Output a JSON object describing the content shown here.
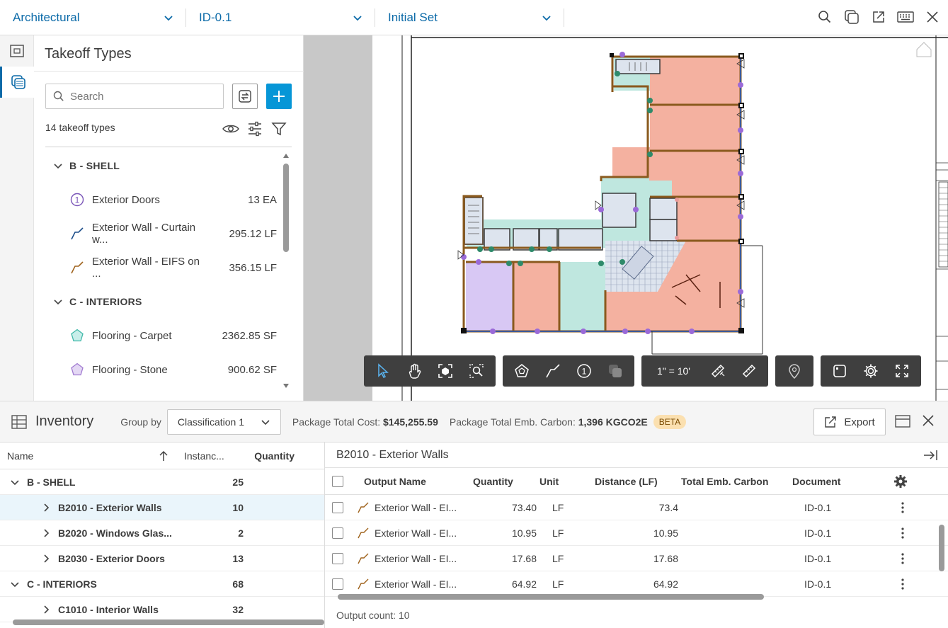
{
  "topbar": {
    "discipline": "Architectural",
    "sheet": "ID-0.1",
    "version_set": "Initial Set",
    "icons": [
      "search-icon",
      "compare-icon",
      "share-icon",
      "keyboard-icon",
      "close-icon"
    ]
  },
  "rail": {
    "icons": [
      "sheets-icon",
      "takeoff-icon"
    ]
  },
  "takeoff": {
    "title": "Takeoff Types",
    "search_placeholder": "Search",
    "count_label": "14 takeoff types",
    "groups": [
      {
        "label": "B - SHELL",
        "items": [
          {
            "name": "Exterior Doors",
            "qty": "13 EA",
            "icon": "count-icon",
            "color": "#7a55b8"
          },
          {
            "name": "Exterior Wall - Curtain w...",
            "qty": "295.12 LF",
            "icon": "linear-icon",
            "color": "#1d4e8a"
          },
          {
            "name": "Exterior Wall - EIFS on ...",
            "qty": "356.15 LF",
            "icon": "linear-icon",
            "color": "#a0641e"
          }
        ]
      },
      {
        "label": "C - INTERIORS",
        "items": [
          {
            "name": "Flooring - Carpet",
            "qty": "2362.85 SF",
            "icon": "area-icon",
            "color": "#3fb8a8"
          },
          {
            "name": "Flooring - Stone",
            "qty": "900.62 SF",
            "icon": "area-icon",
            "color": "#a07ad0"
          }
        ]
      }
    ]
  },
  "viewer": {
    "scale": "1\" = 10'"
  },
  "inventory": {
    "title": "Inventory",
    "group_by_label": "Group by",
    "group_by_value": "Classification 1",
    "cost_label": "Package Total Cost:",
    "cost_value": "$145,255.59",
    "carbon_label": "Package Total Emb. Carbon:",
    "carbon_value": "1,396 KGCO2E",
    "beta": "BETA",
    "export": "Export",
    "left_headers": {
      "name": "Name",
      "instances": "Instanc...",
      "quantity": "Quantity"
    },
    "left_rows": [
      {
        "level": 0,
        "name": "B - SHELL",
        "inst": "25",
        "expanded": true
      },
      {
        "level": 1,
        "name": "B2010 - Exterior Walls",
        "inst": "10",
        "selected": true
      },
      {
        "level": 1,
        "name": "B2020 - Windows Glas...",
        "inst": "2"
      },
      {
        "level": 1,
        "name": "B2030 - Exterior Doors",
        "inst": "13"
      },
      {
        "level": 0,
        "name": "C - INTERIORS",
        "inst": "68",
        "expanded": true
      },
      {
        "level": 1,
        "name": "C1010 - Interior Walls",
        "inst": "32"
      }
    ],
    "detail_title": "B2010 - Exterior Walls",
    "right_headers": {
      "output": "Output Name",
      "qty": "Quantity",
      "unit": "Unit",
      "dist": "Distance (LF)",
      "carbon": "Total Emb. Carbon",
      "doc": "Document"
    },
    "right_rows": [
      {
        "name": "Exterior Wall - EI...",
        "qty": "73.40",
        "unit": "LF",
        "dist": "73.4",
        "carbon": "",
        "doc": "ID-0.1"
      },
      {
        "name": "Exterior Wall - EI...",
        "qty": "10.95",
        "unit": "LF",
        "dist": "10.95",
        "carbon": "",
        "doc": "ID-0.1"
      },
      {
        "name": "Exterior Wall - EI...",
        "qty": "17.68",
        "unit": "LF",
        "dist": "17.68",
        "carbon": "",
        "doc": "ID-0.1"
      },
      {
        "name": "Exterior Wall - EI...",
        "qty": "64.92",
        "unit": "LF",
        "dist": "64.92",
        "carbon": "",
        "doc": "ID-0.1"
      }
    ],
    "output_count": "Output count: 10"
  }
}
